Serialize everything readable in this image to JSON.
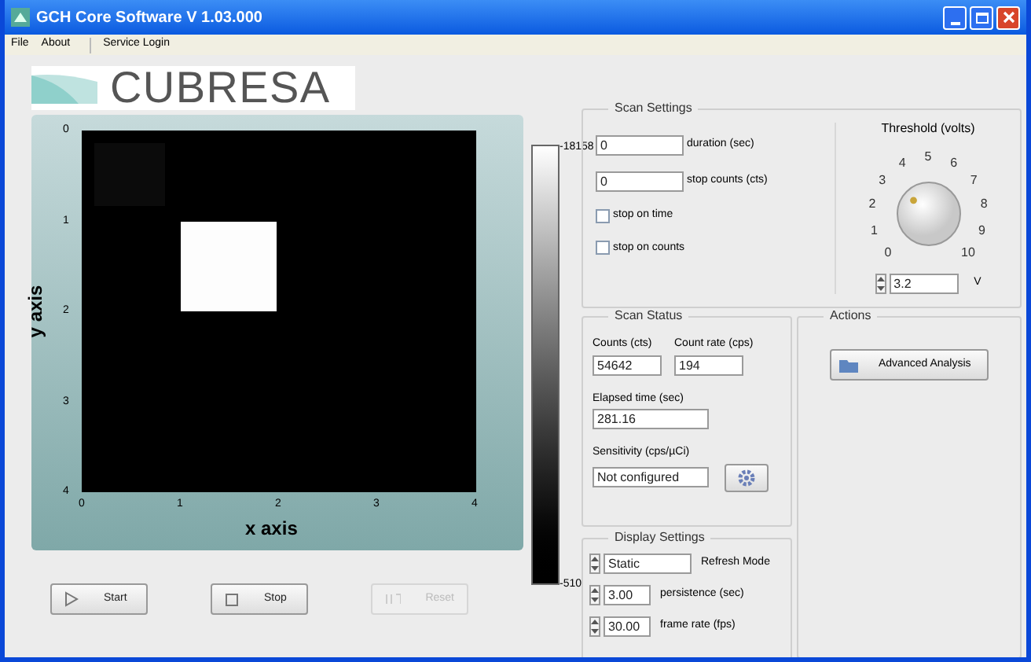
{
  "window": {
    "title": "GCH Core Software V 1.03.000"
  },
  "menu": [
    "File",
    "About",
    "Service Login"
  ],
  "logo": {
    "text": "CUBRESA"
  },
  "plot": {
    "xlabel": "x axis",
    "ylabel": "y axis",
    "xticks": [
      "0",
      "1",
      "2",
      "3",
      "4"
    ],
    "yticks": [
      "0",
      "1",
      "2",
      "3",
      "4"
    ]
  },
  "colorbar": {
    "max": "-18158",
    "min": "-510"
  },
  "buttons": [
    {
      "label": "Start",
      "kind": "start",
      "disabled": false
    },
    {
      "label": "Stop",
      "kind": "stop",
      "disabled": false
    },
    {
      "label": "Reset",
      "kind": "reset",
      "disabled": true
    }
  ],
  "scan_settings": {
    "title": "Scan Settings",
    "duration": {
      "value": "0",
      "label": "duration (sec)"
    },
    "stop_counts": {
      "value": "0",
      "label": "stop counts (cts)"
    },
    "checkboxes": [
      {
        "label": "stop on time",
        "checked": false
      },
      {
        "label": "stop on counts",
        "checked": false
      }
    ],
    "threshold": {
      "title": "Threshold (volts)",
      "scale": [
        "0",
        "1",
        "2",
        "3",
        "4",
        "5",
        "6",
        "7",
        "8",
        "9",
        "10"
      ],
      "level": 0.32,
      "value": "3.2",
      "unit": "V"
    }
  },
  "scan_status": {
    "title": "Scan Status",
    "counts": {
      "label": "Counts (cts)",
      "value": "54642"
    },
    "count_rate": {
      "label": "Count rate (cps)",
      "value": "194"
    },
    "elapsed": {
      "label": "Elapsed time (sec)",
      "value": "281.16"
    },
    "sensitivity": {
      "label": "Sensitivity (cps/µCi)",
      "value": "Not configured"
    }
  },
  "actions": {
    "title": "Actions",
    "button": "Advanced Analysis"
  },
  "display_settings": {
    "title": "Display Settings",
    "refresh": {
      "value": "Static",
      "label": "Refresh Mode"
    },
    "persistence": {
      "value": "3.00",
      "label": "persistence (sec)"
    },
    "frame_rate": {
      "value": "30.00",
      "label": "frame rate (fps)"
    }
  }
}
